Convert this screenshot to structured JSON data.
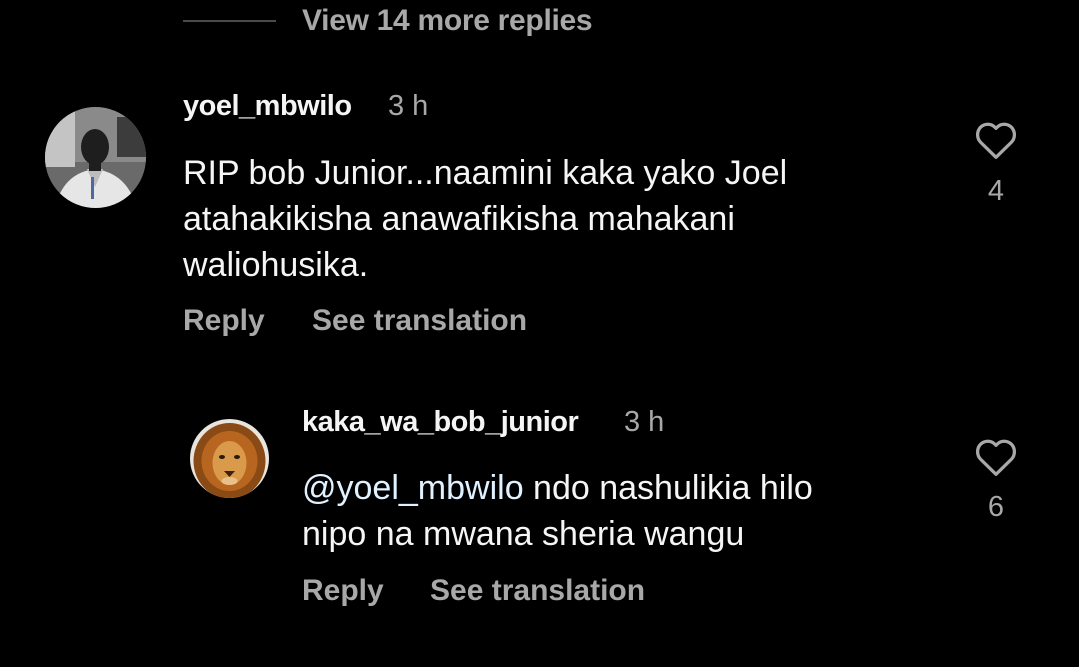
{
  "view_more": {
    "label": "View 14 more replies"
  },
  "comments": [
    {
      "username": "yoel_mbwilo",
      "time": "3 h",
      "text_lines": [
        "RIP bob Junior...naamini kaka yako Joel",
        "atahakikisha anawafikisha mahakani",
        "waliohusika."
      ],
      "reply_label": "Reply",
      "translate_label": "See translation",
      "like_count": "4",
      "avatar_icon": "user-photo-avatar"
    },
    {
      "username": "kaka_wa_bob_junior",
      "time": "3 h",
      "mention": "@yoel_mbwilo",
      "text_line1_rest": " ndo nashulikia hilo",
      "text_line2": "nipo na mwana sheria wangu",
      "reply_label": "Reply",
      "translate_label": "See translation",
      "like_count": "6",
      "avatar_icon": "lion-avatar"
    }
  ],
  "colors": {
    "background": "#000000",
    "primary_text": "#f5f5f5",
    "secondary_text": "#a8a8a8",
    "mention": "#e0f1ff"
  },
  "icons": {
    "like": "heart-outline-icon"
  }
}
